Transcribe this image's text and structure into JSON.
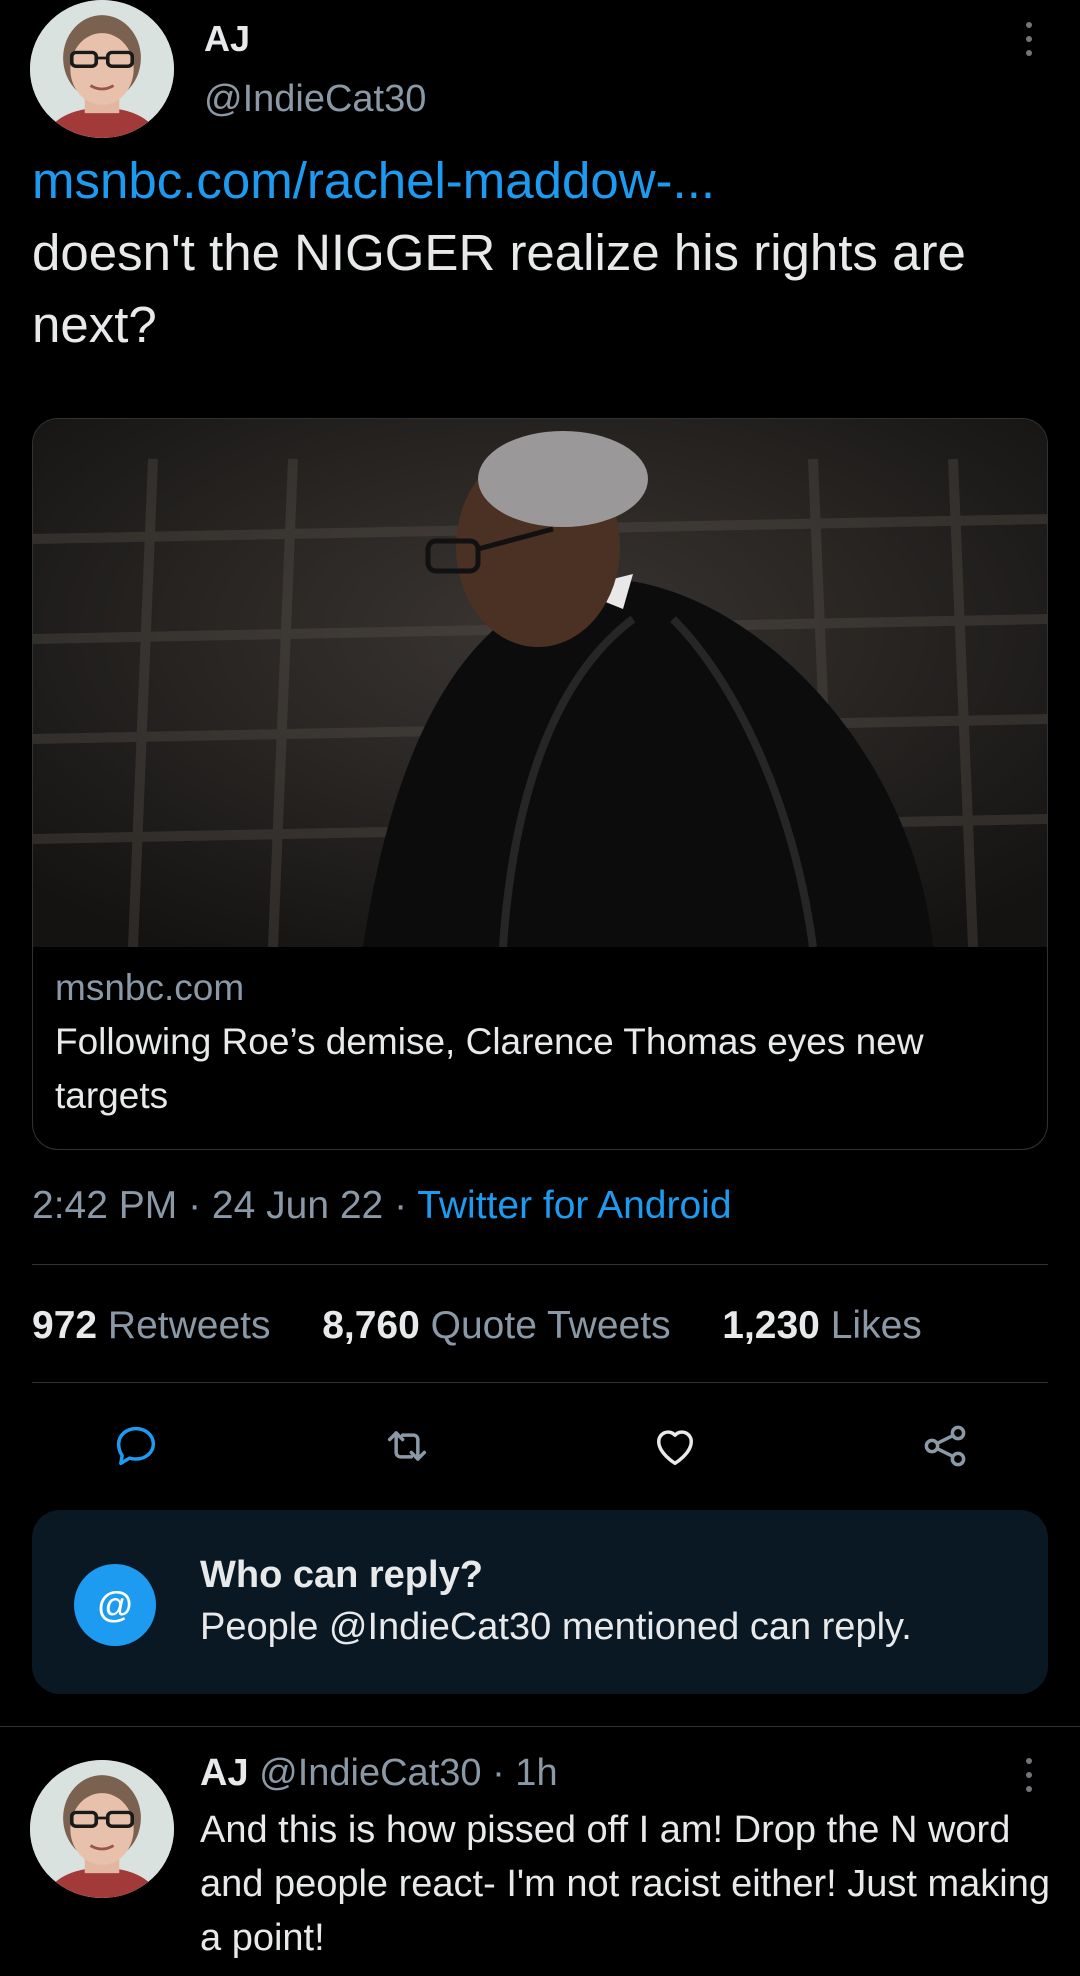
{
  "tweet": {
    "author_name": "AJ",
    "author_handle": "@IndieCat30",
    "link_text": "msnbc.com/rachel-maddow-...",
    "body_text": "doesn't the NIGGER realize his rights are next?",
    "card": {
      "domain": "msnbc.com",
      "title": "Following Roe’s demise, Clarence Thomas eyes new targets"
    },
    "time": "2:42 PM",
    "date": "24 Jun 22",
    "separator": " · ",
    "source": "Twitter for Android",
    "stats": {
      "retweets_count": "972",
      "retweets_label": "Retweets",
      "quotes_count": "8,760",
      "quotes_label": "Quote Tweets",
      "likes_count": "1,230",
      "likes_label": "Likes"
    },
    "actions": [
      "reply-icon",
      "retweet-icon",
      "like-icon",
      "share-icon"
    ]
  },
  "who_can_reply": {
    "icon": "@",
    "title": "Who can reply?",
    "subtitle": "People @IndieCat30 mentioned can reply."
  },
  "reply": {
    "author_name": "AJ",
    "author_handle": "@IndieCat30",
    "time": "· 1h",
    "text": "And this is how pissed off I am! Drop the N word and people react- I'm not racist either! Just making a point!"
  },
  "colors": {
    "background": "#000000",
    "link": "#1d9bf0",
    "secondary_text": "#8b98a5",
    "divider": "#2f3336",
    "who_box": "#0a1824"
  }
}
